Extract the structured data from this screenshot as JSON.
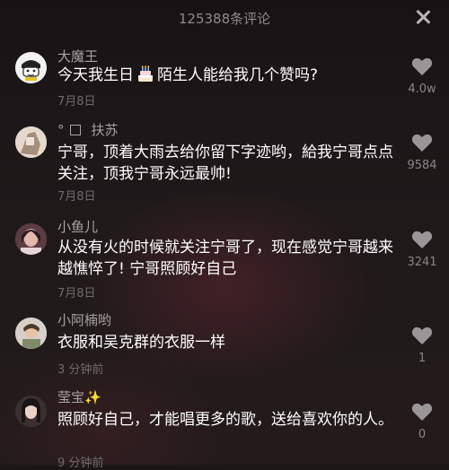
{
  "header": {
    "title": "125388条评论"
  },
  "comments": [
    {
      "username": "大魔王",
      "content_a": "今天我生日",
      "content_b": "陌生人能给我几个赞吗?",
      "time": "7月8日",
      "likes": "4.0w"
    },
    {
      "username_prefix": "°",
      "username": "扶苏",
      "content": "宁哥，顶着大雨去给你留下字迹哟，給我宁哥点点关注，顶我宁哥永远最帅!",
      "time": "7月8日",
      "likes": "9584"
    },
    {
      "username": "小鱼儿",
      "content": "从没有火的时候就关注宁哥了，现在感觉宁哥越来越憔悴了! 宁哥照顾好自己",
      "time": "7月8日",
      "likes": "3241"
    },
    {
      "username": "小阿楠哟",
      "content": "衣服和吴克群的衣服一样",
      "time": "3 分钟前",
      "likes": "1"
    },
    {
      "username": "莹宝",
      "username_suffix": "✨",
      "content": "照顾好自己，才能唱更多的歌，送给喜欢你的人。",
      "time": "9 分钟前",
      "likes": "0"
    }
  ],
  "icons": {
    "heart": "heart-icon",
    "close": "close-icon",
    "cake": "birthday-cake-icon"
  }
}
